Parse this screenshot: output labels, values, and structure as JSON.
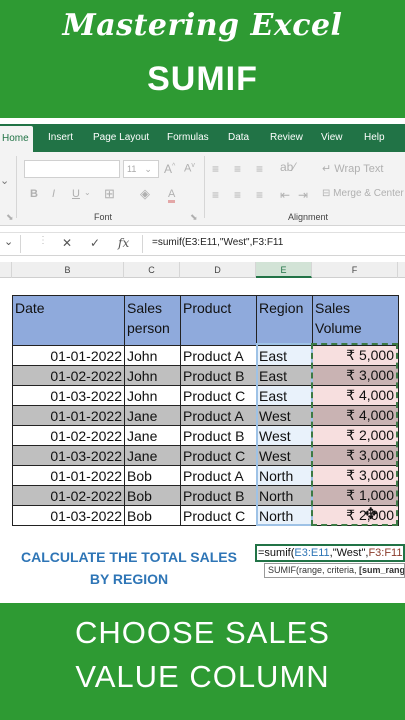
{
  "banner": {
    "title": "Mastering Excel",
    "subtitle": "SUMIF"
  },
  "ribbon": {
    "tabs": [
      "Home",
      "Insert",
      "Page Layout",
      "Formulas",
      "Data",
      "Review",
      "View",
      "Help"
    ],
    "active_tab": "Home",
    "font_size": "11",
    "wrap_text": "Wrap Text",
    "merge_center": "Merge & Center",
    "group_font": "Font",
    "group_alignment": "Alignment"
  },
  "formula_bar": {
    "formula": "=sumif(E3:E11,\"West\",F3:F11"
  },
  "columns": [
    "B",
    "C",
    "D",
    "E",
    "F"
  ],
  "table": {
    "headers": {
      "date": "Date",
      "sales_line1": "Sales",
      "sales_line2": "person",
      "product": "Product",
      "region": "Region",
      "vol_line1": "Sales",
      "vol_line2": "Volume"
    },
    "rows": [
      {
        "date": "01-01-2022",
        "person": "John",
        "product": "Product A",
        "region": "East",
        "volume": "₹ 5,000"
      },
      {
        "date": "01-02-2022",
        "person": "John",
        "product": "Product B",
        "region": "East",
        "volume": "₹ 3,000"
      },
      {
        "date": "01-03-2022",
        "person": "John",
        "product": "Product C",
        "region": "East",
        "volume": "₹ 4,000"
      },
      {
        "date": "01-01-2022",
        "person": "Jane",
        "product": "Product A",
        "region": "West",
        "volume": "₹ 4,000"
      },
      {
        "date": "01-02-2022",
        "person": "Jane",
        "product": "Product B",
        "region": "West",
        "volume": "₹ 2,000"
      },
      {
        "date": "01-03-2022",
        "person": "Jane",
        "product": "Product C",
        "region": "West",
        "volume": "₹ 3,000"
      },
      {
        "date": "01-01-2022",
        "person": "Bob",
        "product": "Product A",
        "region": "North",
        "volume": "₹ 3,000"
      },
      {
        "date": "01-02-2022",
        "person": "Bob",
        "product": "Product B",
        "region": "North",
        "volume": "₹ 1,000"
      },
      {
        "date": "01-03-2022",
        "person": "Bob",
        "product": "Product C",
        "region": "North",
        "volume": "₹ 2,000"
      }
    ]
  },
  "instruction": "CALCULATE THE TOTAL SALES BY REGION",
  "edit_cell": {
    "prefix": "=sumif(",
    "range1": "E3:E11",
    "middle": ",\"West\",",
    "range2": "F3:F11"
  },
  "tooltip": {
    "text": "SUMIF(range, criteria, ",
    "bold": "[sum_range])"
  },
  "bottom_banner": {
    "line1": "CHOOSE SALES",
    "line2": "VALUE COLUMN"
  }
}
